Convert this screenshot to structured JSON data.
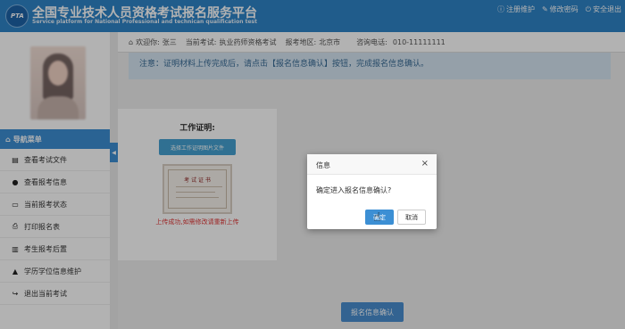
{
  "header": {
    "logo_text": "PTA",
    "title": "全国专业技术人员资格考试报名服务平台",
    "subtitle": "Service platform for National Professional and technican qualification test",
    "links": [
      {
        "icon": "info-icon",
        "glyph": "ⓘ",
        "label": "注册维护"
      },
      {
        "icon": "edit-icon",
        "glyph": "✎",
        "label": "修改密码"
      },
      {
        "icon": "logout-icon",
        "glyph": "⏻",
        "label": "安全退出"
      }
    ]
  },
  "infobar": {
    "welcome_label": "欢迎你:",
    "user_name": "张三",
    "exam_label": "当前考试:",
    "exam_value": "执业药师资格考试",
    "region_label": "报考地区:",
    "region_value": "北京市",
    "phone_label": "咨询电话:",
    "phone_value": "010-11111111"
  },
  "sidebar": {
    "nav_title": "导航菜单",
    "items": [
      {
        "icon": "file-icon",
        "glyph": "▤",
        "label": "查看考试文件"
      },
      {
        "icon": "info-icon",
        "glyph": "●",
        "label": "查看报考信息"
      },
      {
        "icon": "monitor-icon",
        "glyph": "▭",
        "label": "当前报考状态"
      },
      {
        "icon": "print-icon",
        "glyph": "⎙",
        "label": "打印报名表"
      },
      {
        "icon": "book-icon",
        "glyph": "▥",
        "label": "考生报考后置"
      },
      {
        "icon": "graduation-icon",
        "glyph": "▲",
        "label": "学历学位信息维护"
      },
      {
        "icon": "exit-icon",
        "glyph": "↪",
        "label": "退出当前考试"
      }
    ]
  },
  "main": {
    "notice": "注意：证明材料上传完成后，请点击【报名信息确认】按钮，完成报名信息确认。",
    "cert_title": "工作证明:",
    "upload_button": "选择工作证明图片文件",
    "cert_image_heading": "考 试 证 书",
    "upload_status": "上传成功,如需修改请重新上传",
    "confirm_button": "报名信息确认"
  },
  "dialog": {
    "title": "信息",
    "close": "×",
    "message": "确定进入报名信息确认?",
    "ok_label": "确定",
    "cancel_label": "取消"
  },
  "colors": {
    "header_bg": "#2f84c8",
    "nav_active": "#3d8ed3",
    "error_text": "#e03434"
  }
}
